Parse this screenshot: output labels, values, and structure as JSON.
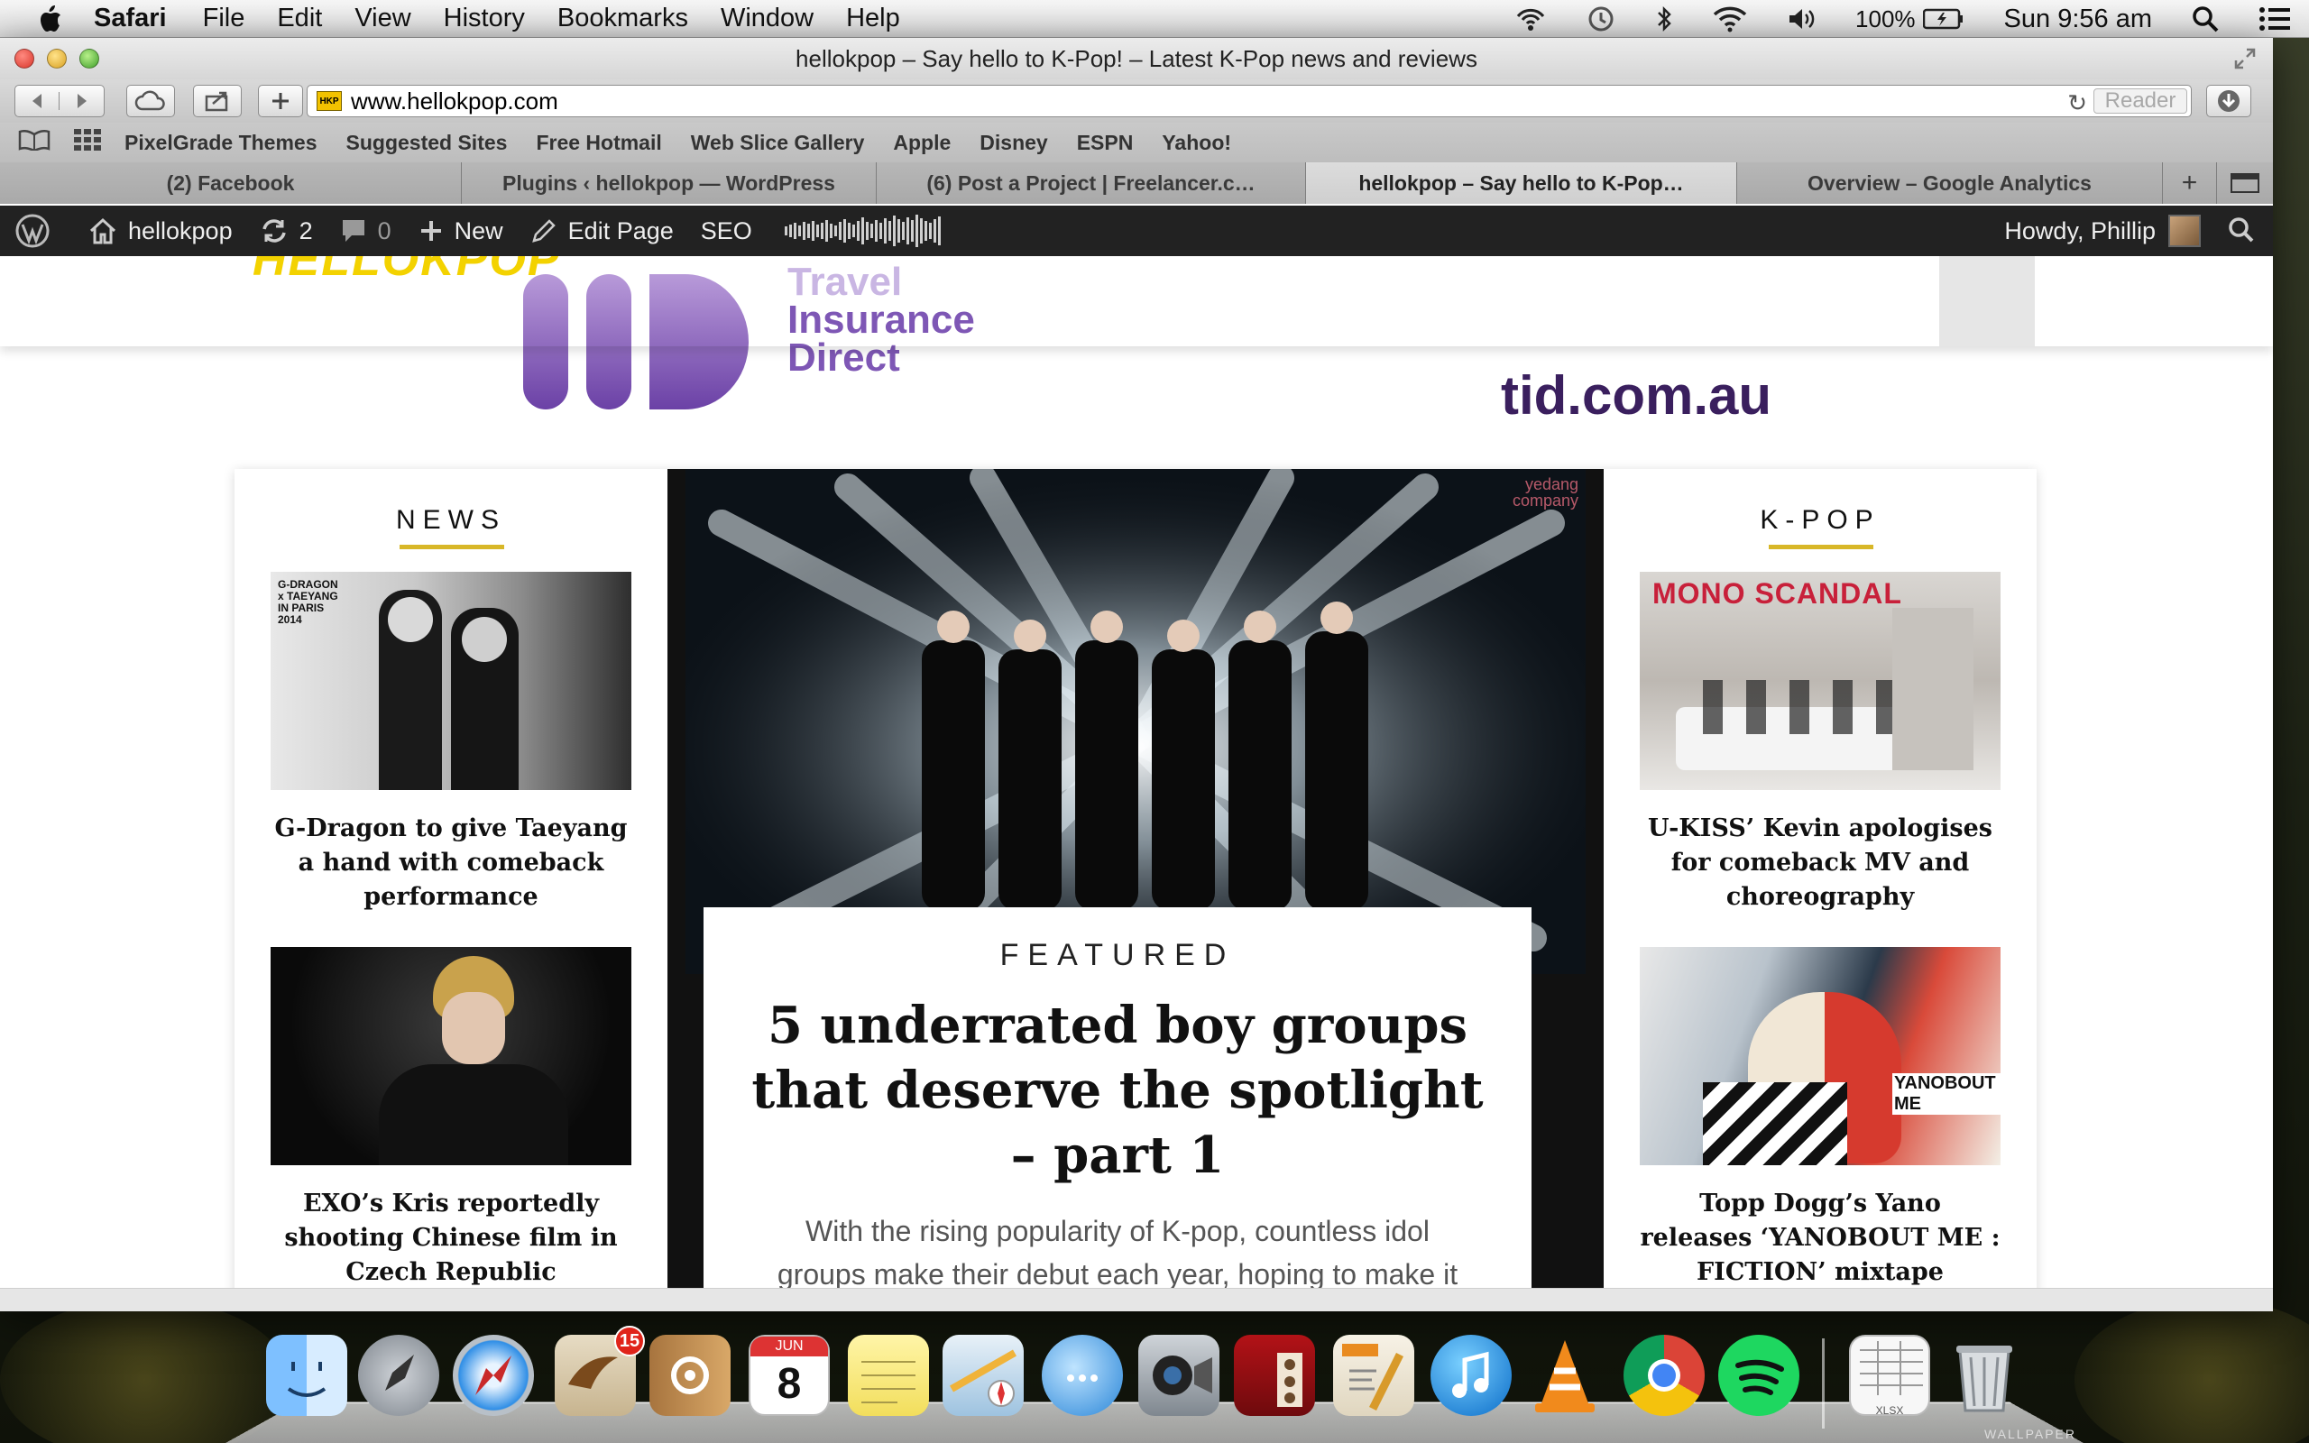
{
  "menubar": {
    "app_name": "Safari",
    "items": [
      "File",
      "Edit",
      "View",
      "History",
      "Bookmarks",
      "Window",
      "Help"
    ],
    "battery": "100%",
    "clock": "Sun 9:56 am"
  },
  "window": {
    "title": "hellokpop – Say hello to K-Pop! – Latest K-Pop news and reviews",
    "url": "www.hellokpop.com",
    "favicon_text": "HKP",
    "reader_label": "Reader"
  },
  "bookmarks": [
    "PixelGrade Themes",
    "Suggested Sites",
    "Free Hotmail",
    "Web Slice Gallery",
    "Apple",
    "Disney",
    "ESPN",
    "Yahoo!"
  ],
  "tabs": [
    {
      "label": "(2) Facebook",
      "active": false
    },
    {
      "label": "Plugins ‹ hellokpop — WordPress",
      "active": false
    },
    {
      "label": "(6) Post a Project | Freelancer.c…",
      "active": false
    },
    {
      "label": "hellokpop – Say hello to K-Pop…",
      "active": true
    },
    {
      "label": "Overview – Google Analytics",
      "active": false
    }
  ],
  "adminbar": {
    "site_name": "hellokpop",
    "updates_count": "2",
    "comments_count": "0",
    "new_label": "New",
    "edit_label": "Edit Page",
    "seo_label": "SEO",
    "howdy": "Howdy, Phillip"
  },
  "site": {
    "logo_text": "HELLOKPOP"
  },
  "ad": {
    "brand_line1": "Travel",
    "brand_line2": "Insurance",
    "brand_line3": "Direct",
    "url": "tid.com.au"
  },
  "news": {
    "section_title": "NEWS",
    "cards": [
      {
        "title": "G-Dragon to give Taeyang a hand with comeback performance",
        "thumb_caption": "G-DRAGON x TAEYANG IN PARIS 2014"
      },
      {
        "title": "EXO’s Kris reportedly shooting Chinese film in Czech Republic"
      }
    ]
  },
  "featured": {
    "label": "FEATURED",
    "title": "5 underrated boy groups that deserve the spotlight – part 1",
    "excerpt": "With the rising popularity of K-pop, countless idol groups make their debut each year, hoping to make it big like BIG...",
    "watermark": "yedang company"
  },
  "kpop": {
    "section_title": "K-POP",
    "cards": [
      {
        "title": "U-KISS’ Kevin apologises for comeback MV and choreography",
        "thumb_caption": "MONO SCANDAL"
      },
      {
        "title": "Topp Dogg’s Yano releases ‘YANOBOUT ME : FICTION’ mixtape",
        "thumb_caption": "YANOBOUT ME"
      }
    ]
  },
  "dock": {
    "mail_badge": "15",
    "calendar_month": "JUN",
    "calendar_day": "8",
    "xlsx_label": "XLSX",
    "wallpaper_tag": "WALLPAPER"
  }
}
